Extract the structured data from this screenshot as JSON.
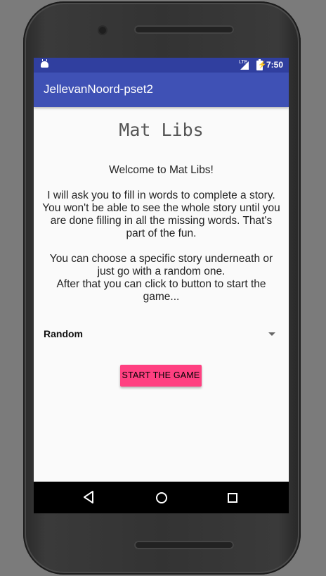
{
  "status_bar": {
    "network": "LTE",
    "time": "7:50"
  },
  "app_bar": {
    "title": "JellevanNoord-pset2"
  },
  "main": {
    "heading": "Mat Libs",
    "intro_text": "Welcome to Mat Libs!\n\nI will ask you to fill in words to complete a story. You won't be able to see the whole story until you are done filling in all the missing words. That's part of the fun.\n\nYou can choose a specific story underneath or just go with a random one.\n After that you can click to button to start the game...",
    "story_select": {
      "selected": "Random"
    },
    "start_button_label": "START THE GAME"
  },
  "colors": {
    "status_bar": "#303f9f",
    "app_bar": "#3f51b5",
    "accent": "#ff4081",
    "background": "#fafafa"
  },
  "icons": [
    "android-notification-icon",
    "signal-icon",
    "battery-charging-icon",
    "back-icon",
    "home-icon",
    "recents-icon"
  ]
}
